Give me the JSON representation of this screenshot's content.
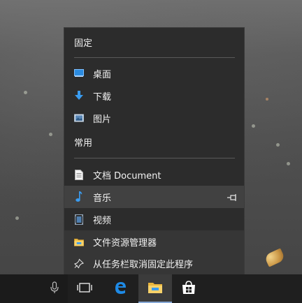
{
  "jump_list": {
    "pinned_header": "固定",
    "pinned": [
      {
        "label": "桌面",
        "icon": "desktop-icon"
      },
      {
        "label": "下载",
        "icon": "download-icon"
      },
      {
        "label": "图片",
        "icon": "pictures-icon"
      }
    ],
    "frequent_header": "常用",
    "frequent": [
      {
        "label": "文档 Document",
        "icon": "document-icon"
      },
      {
        "label": "音乐",
        "icon": "music-icon"
      },
      {
        "label": "视频",
        "icon": "video-icon"
      }
    ],
    "actions": [
      {
        "label": "文件资源管理器",
        "icon": "folder-icon"
      },
      {
        "label": "从任务栏取消固定此程序",
        "icon": "unpin-icon"
      }
    ]
  },
  "taskbar": {
    "buttons": [
      "microphone-icon",
      "task-view-icon",
      "edge-icon",
      "file-explorer-icon",
      "store-icon"
    ],
    "active": "file-explorer-icon"
  },
  "colors": {
    "menu_bg": "#2c2c2c",
    "hover_bg": "#414141",
    "taskbar_bg": "#1f1f1f",
    "accent": "#0078d7"
  }
}
